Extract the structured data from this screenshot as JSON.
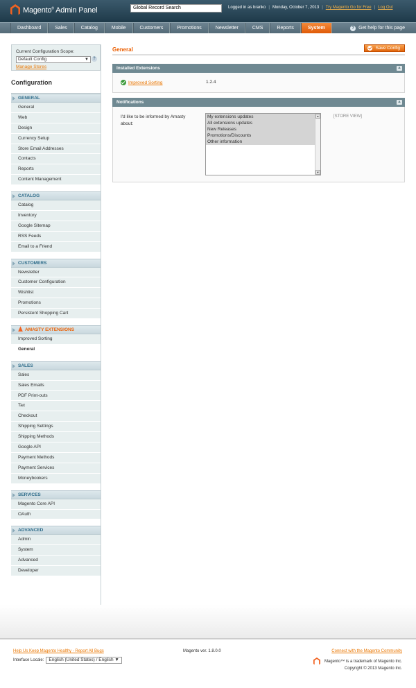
{
  "header": {
    "brand": "Magento",
    "brand_suffix": "Admin Panel",
    "search_value": "Global Record Search",
    "logged_in": "Logged in as branko",
    "date": "Monday, October 7, 2013",
    "try_link": "Try Magento Go for Free",
    "logout": "Log Out"
  },
  "nav": {
    "items": [
      "Dashboard",
      "Sales",
      "Catalog",
      "Mobile",
      "Customers",
      "Promotions",
      "Newsletter",
      "CMS",
      "Reports",
      "System"
    ],
    "active": "System",
    "help": "Get help for this page"
  },
  "sidebar": {
    "scope_label": "Current Configuration Scope:",
    "scope_value": "Default Config",
    "manage_stores": "Manage Stores",
    "title": "Configuration",
    "sections": [
      {
        "title": "GENERAL",
        "items": [
          "General",
          "Web",
          "Design",
          "Currency Setup",
          "Store Email Addresses",
          "Contacts",
          "Reports",
          "Content Management"
        ]
      },
      {
        "title": "CATALOG",
        "items": [
          "Catalog",
          "Inventory",
          "Google Sitemap",
          "RSS Feeds",
          "Email to a Friend"
        ]
      },
      {
        "title": "CUSTOMERS",
        "items": [
          "Newsletter",
          "Customer Configuration",
          "Wishlist",
          "Promotions",
          "Persistent Shopping Cart"
        ]
      },
      {
        "title": "AMASTY EXTENSIONS",
        "items": [
          "Improved Sorting",
          "General"
        ]
      },
      {
        "title": "SALES",
        "items": [
          "Sales",
          "Sales Emails",
          "PDF Print-outs",
          "Tax",
          "Checkout",
          "Shipping Settings",
          "Shipping Methods",
          "Google API",
          "Payment Methods",
          "Payment Services",
          "Moneybookers"
        ]
      },
      {
        "title": "SERVICES",
        "items": [
          "Magento Core API",
          "OAuth"
        ]
      },
      {
        "title": "ADVANCED",
        "items": [
          "Admin",
          "System",
          "Advanced",
          "Developer"
        ]
      }
    ]
  },
  "main": {
    "title": "General",
    "save_button": "Save Config",
    "installed": {
      "heading": "Installed Extensions",
      "name": "Improved Sorting",
      "version": "1.2.4"
    },
    "notifications": {
      "heading": "Notifications",
      "label": "I'd like to be informed by Amasty about:",
      "options": [
        "My extensions updates",
        "All extensions updates",
        "New Releases",
        "Promotions/Discounts",
        "Other information"
      ],
      "scope": "[STORE VIEW]"
    }
  },
  "footer": {
    "help_link": "Help Us Keep Magento Healthy - Report All Bugs",
    "locale_label": "Interface Locale:",
    "locale_value": "English (United States) / English",
    "version": "Magento ver. 1.8.0.0",
    "community_link": "Connect with the Magento Community",
    "trademark": "Magento™ is a trademark of Magento Inc.",
    "copyright": "Copyright © 2013 Magento Inc."
  }
}
